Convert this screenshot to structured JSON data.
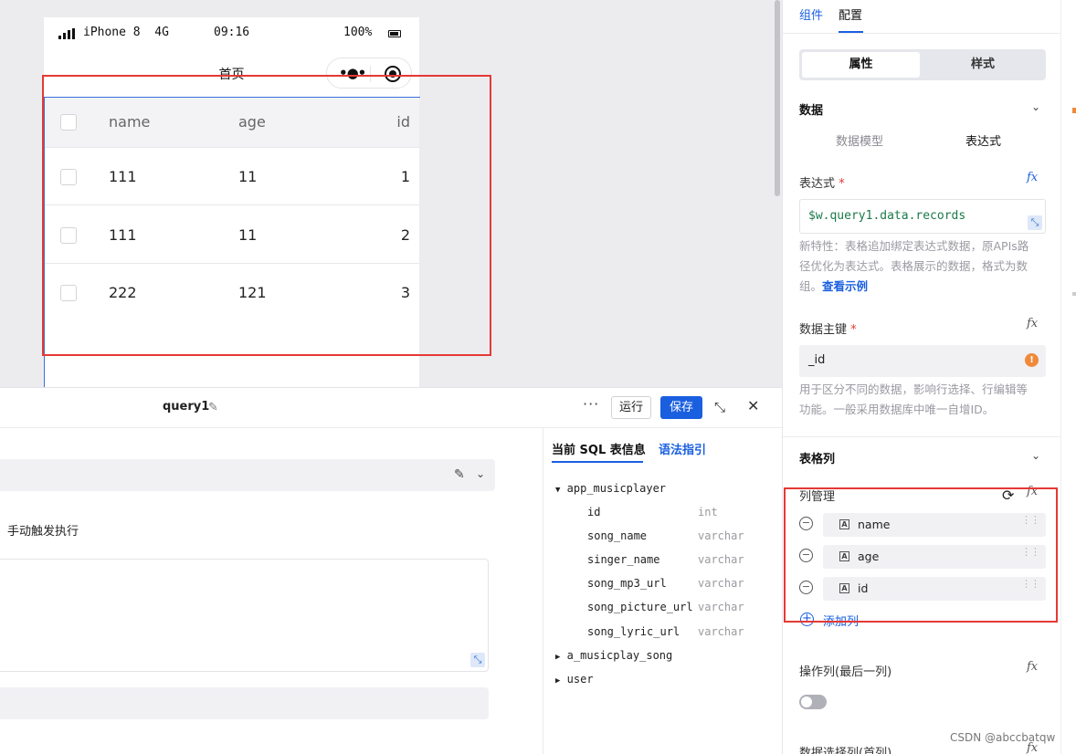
{
  "phone": {
    "model": "iPhone 8",
    "network": "4G",
    "time": "09:16",
    "battery": "100%",
    "page_title": "首页"
  },
  "table": {
    "headers": [
      "name",
      "age",
      "id"
    ],
    "rows": [
      {
        "name": "111",
        "age": "11",
        "id": "1"
      },
      {
        "name": "111",
        "age": "11",
        "id": "2"
      },
      {
        "name": "222",
        "age": "121",
        "id": "3"
      }
    ]
  },
  "query_panel": {
    "title": "query1",
    "run_label": "运行",
    "save_label": "保存",
    "trigger_text": "手动触发执行",
    "tabs": [
      "当前 SQL 表信息",
      "语法指引"
    ],
    "schema": [
      {
        "table": "app_musicplayer",
        "expanded": true,
        "columns": [
          {
            "name": "id",
            "type": "int"
          },
          {
            "name": "song_name",
            "type": "varchar"
          },
          {
            "name": "singer_name",
            "type": "varchar"
          },
          {
            "name": "song_mp3_url",
            "type": "varchar"
          },
          {
            "name": "song_picture_url",
            "type": "varchar"
          },
          {
            "name": "song_lyric_url",
            "type": "varchar"
          }
        ]
      },
      {
        "table": "a_musicplay_song",
        "expanded": false
      },
      {
        "table": "user",
        "expanded": false
      }
    ]
  },
  "config": {
    "tabs": [
      "组件",
      "配置"
    ],
    "segments": [
      "属性",
      "样式"
    ],
    "data_section": {
      "title": "数据",
      "source_options": [
        "数据模型",
        "表达式"
      ],
      "expression_label": "表达式",
      "expression_value": "$w.query1.data.records",
      "help_lines": [
        "新特性：表格追加绑定表达式数据，原APIs路",
        "径优化为表达式。表格展示的数据，格式为数",
        "组。"
      ],
      "see_example": "查看示例",
      "pk_label": "数据主键",
      "pk_value": "_id",
      "pk_help_lines": [
        "用于区分不同的数据，影响行选择、行编辑等",
        "功能。一般采用数据库中唯一自增ID。"
      ]
    },
    "columns_section": {
      "title": "表格列",
      "manage_label": "列管理",
      "columns": [
        "name",
        "age",
        "id"
      ],
      "add_label": "添加列"
    },
    "action_col_label": "操作列(最后一列)",
    "select_col_label": "数据选择列(首列)"
  },
  "watermark": "CSDN @abccbatqw",
  "colors": {
    "accent": "#1a5fe0",
    "annotation": "#e53935",
    "warning": "#f08a3a"
  }
}
